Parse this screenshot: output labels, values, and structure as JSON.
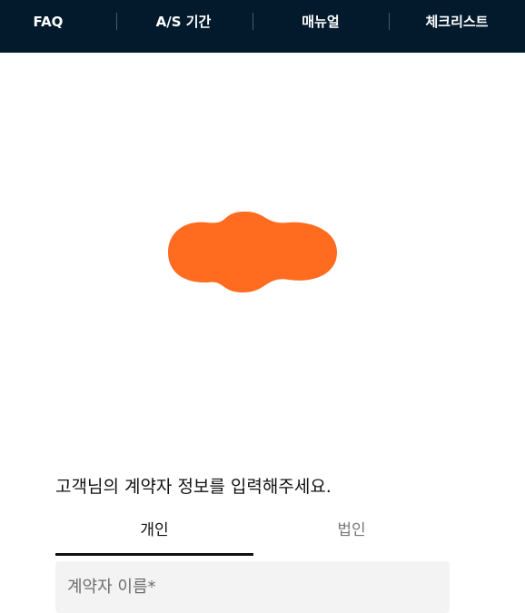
{
  "nav": {
    "items": [
      {
        "label": "FAQ"
      },
      {
        "label": "A/S 기간"
      },
      {
        "label": "매뉴얼"
      },
      {
        "label": "체크리스트"
      }
    ]
  },
  "hero": {
    "icon": "orange-blob-illustration",
    "color": "#ff6b1f"
  },
  "form": {
    "intro": "고객님의 계약자 정보를 입력해주세요.",
    "tabs": [
      {
        "label": "개인",
        "active": true
      },
      {
        "label": "법인",
        "active": false
      }
    ],
    "name_field": {
      "placeholder": "계약자 이름*",
      "value": ""
    }
  },
  "colors": {
    "nav_background": "#021a2c",
    "accent": "#ff6b1f",
    "field_background": "#f3f3f3"
  }
}
